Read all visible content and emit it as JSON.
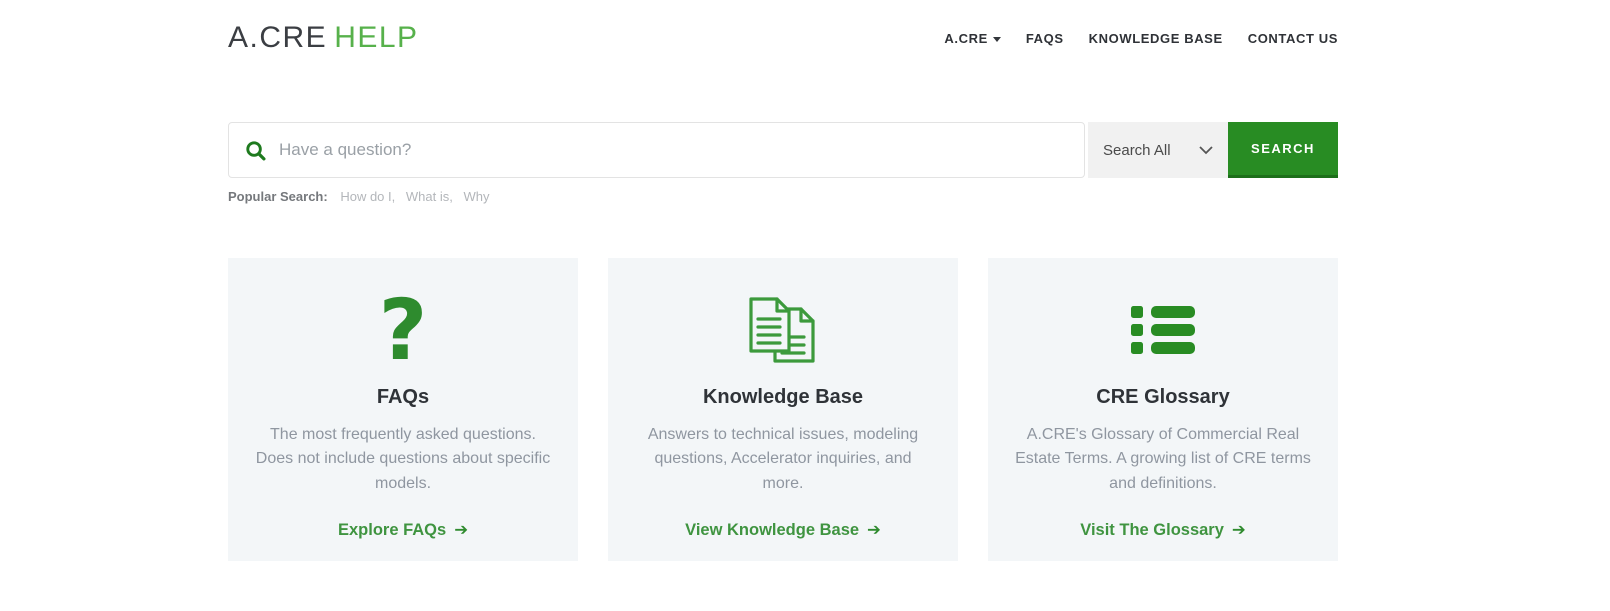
{
  "colors": {
    "primary_green": "#288c23",
    "logo_green": "#57b14b",
    "link_green": "#3f9440",
    "icon_green": "#2e8b2e",
    "dark_text": "#2f3237",
    "muted_text": "#8f96a0",
    "card_background": "#f3f6f8"
  },
  "header": {
    "logo": {
      "part1": "A.CRE",
      "part2": "HELP"
    },
    "nav": [
      {
        "label": "A.CRE",
        "has_dropdown": true
      },
      {
        "label": "FAQS",
        "has_dropdown": false
      },
      {
        "label": "KNOWLEDGE BASE",
        "has_dropdown": false
      },
      {
        "label": "CONTACT US",
        "has_dropdown": false
      }
    ]
  },
  "search": {
    "placeholder": "Have a question?",
    "filter_value": "Search All",
    "button_label": "SEARCH",
    "popular": {
      "label": "Popular Search:",
      "items": [
        "How do I,",
        "What is,",
        "Why"
      ]
    }
  },
  "icons": {
    "search": "magnifier",
    "filter_chevron": "chevron-down",
    "nav_caret": "caret-down",
    "question_mark_glyph": "?",
    "link_arrow_glyph": "➔"
  },
  "cards": [
    {
      "icon": "question-mark-icon",
      "title": "FAQs",
      "description": "The most frequently asked questions. Does not include questions about specific models.",
      "link_label": "Explore FAQs"
    },
    {
      "icon": "documents-icon",
      "title": "Knowledge Base",
      "description": "Answers to technical issues, modeling questions, Accelerator inquiries, and more.",
      "link_label": "View Knowledge Base"
    },
    {
      "icon": "list-icon",
      "title": "CRE Glossary",
      "description": "A.CRE's Glossary of Commercial Real Estate Terms. A growing list of CRE terms and definitions.",
      "link_label": "Visit The Glossary"
    }
  ]
}
